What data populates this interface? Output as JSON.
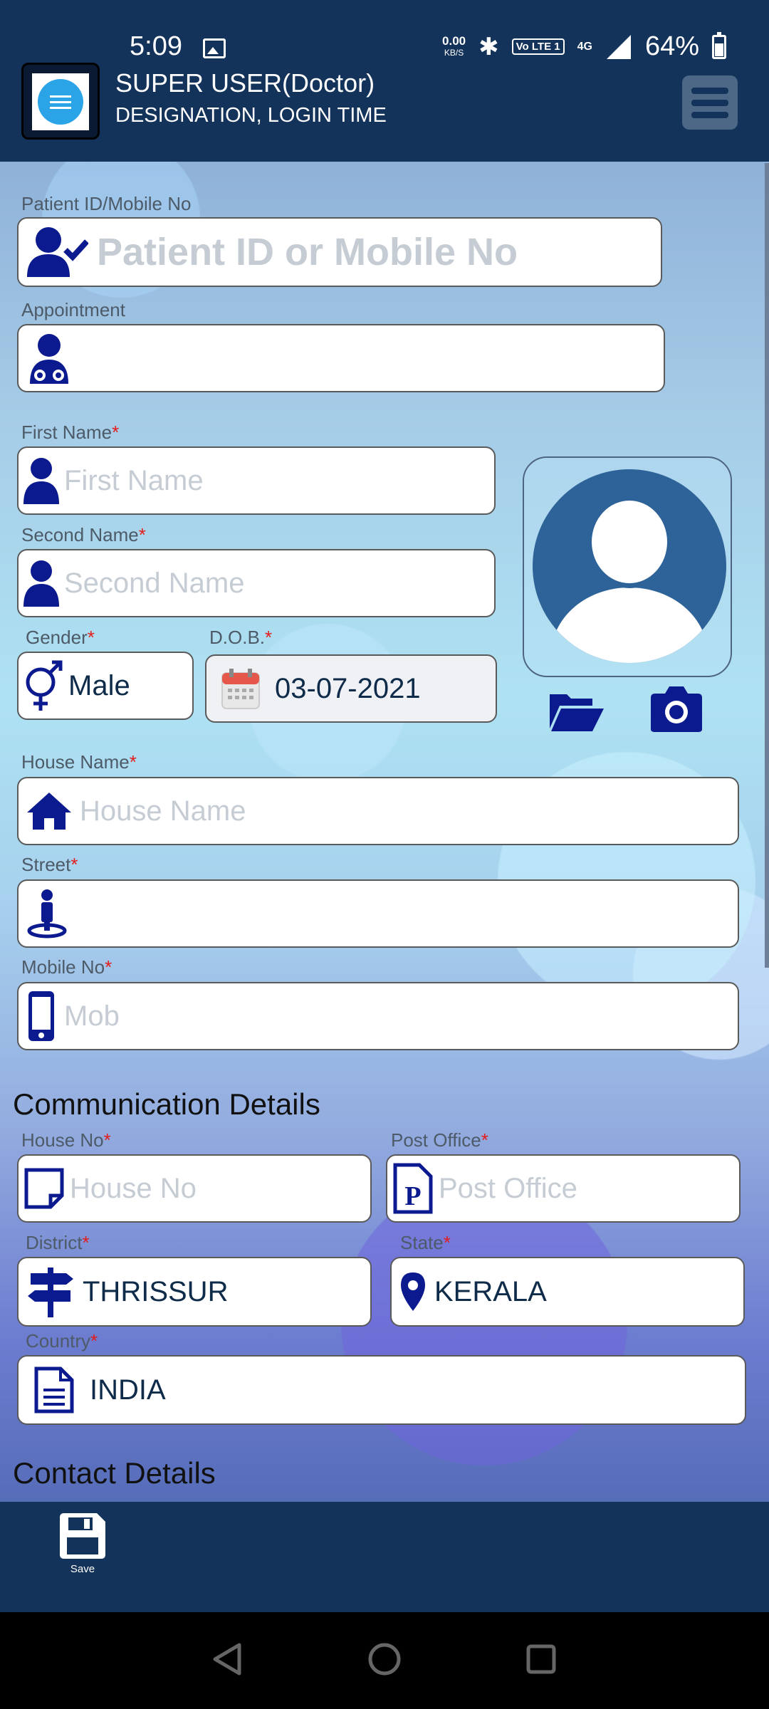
{
  "status_bar": {
    "time": "5:09",
    "net_speed_value": "0.00",
    "net_speed_unit": "KB/S",
    "volte": "Vo LTE 1",
    "network": "4G",
    "battery": "64%"
  },
  "header": {
    "user": "SUPER USER(Doctor)",
    "subtitle": "DESIGNATION, LOGIN TIME"
  },
  "form": {
    "patient_id": {
      "label": "Patient ID/Mobile No",
      "placeholder": "Patient ID or Mobile No"
    },
    "appointment": {
      "label": "Appointment",
      "value": ""
    },
    "first_name": {
      "label": "First Name",
      "required": "*",
      "placeholder": "First Name"
    },
    "second_name": {
      "label": "Second Name",
      "required": "*",
      "placeholder": "Second Name"
    },
    "gender": {
      "label": "Gender",
      "required": "*",
      "value": "Male"
    },
    "dob": {
      "label": "D.O.B.",
      "required": "*",
      "value": "03-07-2021"
    },
    "house_name": {
      "label": "House Name",
      "required": "*",
      "placeholder": "House Name"
    },
    "street": {
      "label": "Street",
      "required": "*",
      "value": ""
    },
    "mobile": {
      "label": "Mobile No",
      "required": "*",
      "placeholder": "Mob"
    }
  },
  "communication": {
    "title": "Communication Details",
    "house_no": {
      "label": "House No",
      "required": "*",
      "placeholder": "House No"
    },
    "post_office": {
      "label": "Post Office",
      "required": "*",
      "placeholder": "Post Office"
    },
    "district": {
      "label": "District",
      "required": "*",
      "value": "THRISSUR"
    },
    "state": {
      "label": "State",
      "required": "*",
      "value": "KERALA"
    },
    "country": {
      "label": "Country",
      "required": "*",
      "value": "INDIA"
    }
  },
  "contact": {
    "title": "Contact Details"
  },
  "bottom_bar": {
    "save_label": "Save"
  },
  "colors": {
    "header_bg": "#13335a",
    "icon_navy": "#0c1a8f",
    "required": "#e41c1c",
    "avatar_bg": "#2d6398"
  },
  "icons": {
    "patient_id": "user-check-icon",
    "appointment": "doctor-icon",
    "name": "user-icon",
    "gender": "gender-icon",
    "dob": "calendar-icon",
    "house": "home-icon",
    "street": "street-view-icon",
    "mobile": "mobile-icon",
    "house_no": "sticky-note-icon",
    "post_office": "post-office-icon",
    "district": "signpost-icon",
    "state": "map-pin-icon",
    "country": "document-icon",
    "folder": "folder-open-icon",
    "camera": "camera-icon",
    "save": "floppy-disk-icon"
  }
}
